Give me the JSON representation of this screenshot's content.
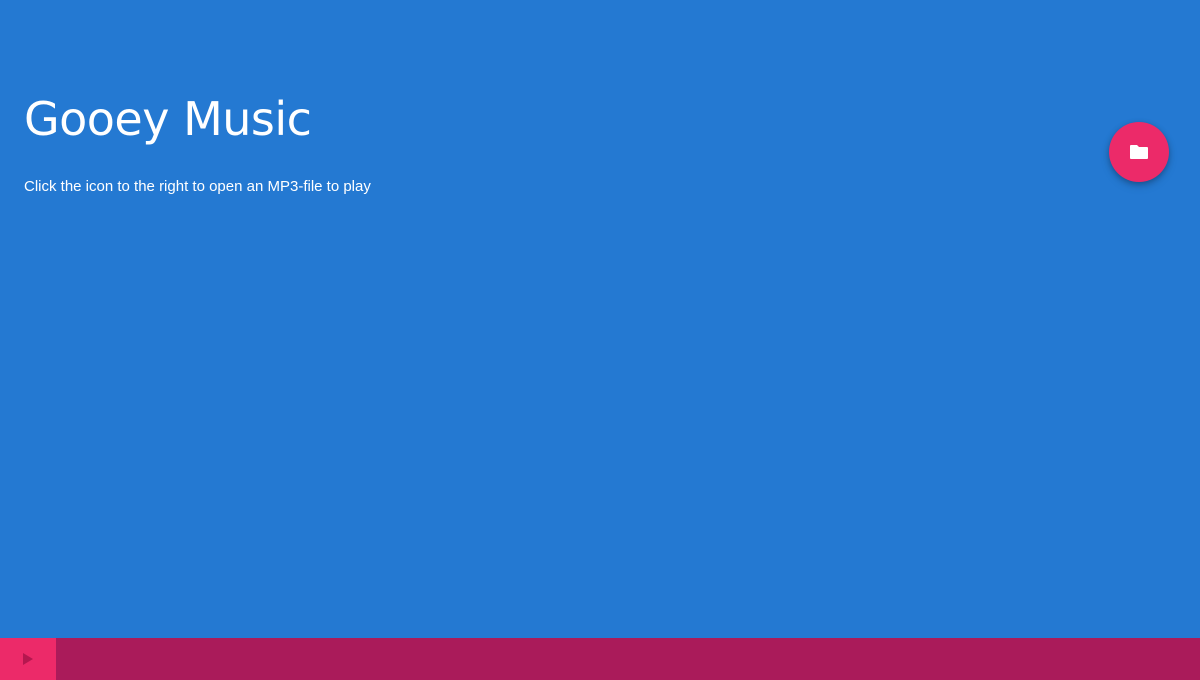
{
  "app": {
    "title": "Gooey Music",
    "instructions": "Click the icon to the right to open an MP3-file to play"
  },
  "open_file_button": {
    "icon": "folder-icon"
  },
  "player": {
    "play_icon": "play-icon",
    "progress": 0
  },
  "colors": {
    "background": "#2479d2",
    "accent": "#ec2a69",
    "player_bar": "#aa1b5a",
    "text": "#ffffff"
  }
}
